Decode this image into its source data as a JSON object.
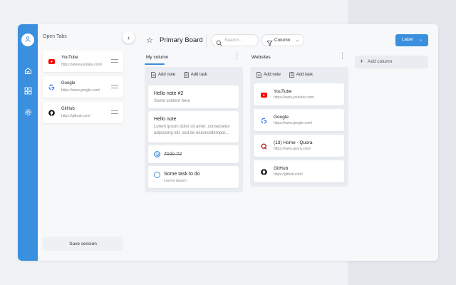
{
  "colors": {
    "accent": "#3a8fdf",
    "youtube": "#ff0000",
    "quora": "#b92b27"
  },
  "sidebar": {
    "nav": [
      {
        "icon": "user-icon"
      },
      {
        "icon": "home-icon"
      },
      {
        "icon": "grid-icon"
      },
      {
        "icon": "gear-icon"
      }
    ]
  },
  "open_tabs": {
    "title": "Open Tabs",
    "items": [
      {
        "title": "YouTube",
        "url": "https://www.youtube.com/",
        "icon": "youtube-icon"
      },
      {
        "title": "Google",
        "url": "https://www.google.com/",
        "icon": "google-icon"
      },
      {
        "title": "GitHub",
        "url": "https://github.com/",
        "icon": "github-icon"
      }
    ],
    "save_label": "Save session"
  },
  "board": {
    "title": "Primary Board",
    "search_placeholder": "Search...",
    "filter_label": "Column",
    "label_button": "Label",
    "add_column_label": "Add column"
  },
  "columns": [
    {
      "title": "My column",
      "add_note": "Add note",
      "add_task": "Add task",
      "notes": [
        {
          "title": "Hello note #2",
          "body": "Some content here"
        },
        {
          "title": "Hello note",
          "body": "Lorem ipsum dolor sit amet, consectetur adipiscing elit, sed do eiusmodtempor..."
        }
      ],
      "tasks": [
        {
          "text": "Todo #2",
          "done": true
        },
        {
          "text": "Some task to do",
          "sub": "Lorem ipsum",
          "done": false
        }
      ]
    },
    {
      "title": "Websites",
      "add_note": "Add note",
      "add_task": "Add task",
      "links": [
        {
          "title": "YouTube",
          "url": "https://www.youtube.com/",
          "icon": "youtube-icon"
        },
        {
          "title": "Google",
          "url": "https://www.google.com/",
          "icon": "google-icon"
        },
        {
          "title": "(13) Home - Quora",
          "url": "https://www.quora.com/",
          "icon": "quora-icon"
        },
        {
          "title": "GitHub",
          "url": "https://github.com/",
          "icon": "github-icon"
        }
      ]
    }
  ]
}
